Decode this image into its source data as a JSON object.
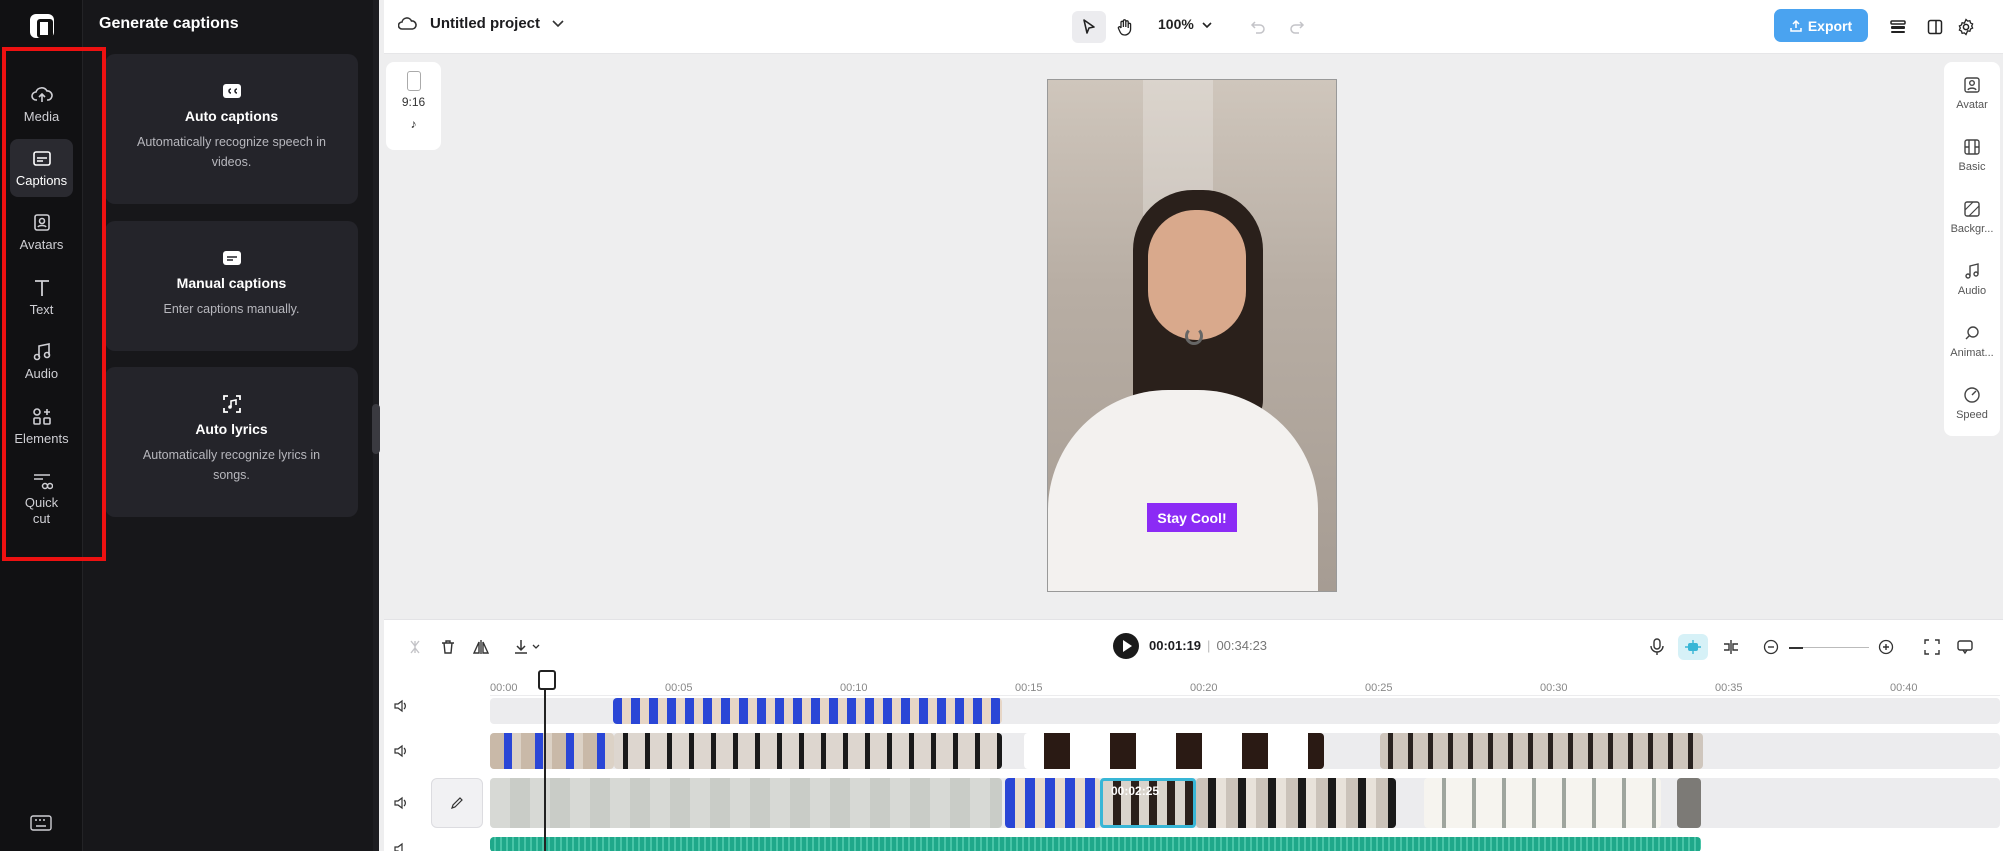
{
  "rail": {
    "items": [
      {
        "label": "Media",
        "icon": "cloud-upload-icon"
      },
      {
        "label": "Captions",
        "icon": "captions-icon"
      },
      {
        "label": "Avatars",
        "icon": "avatar-icon"
      },
      {
        "label": "Text",
        "icon": "text-icon"
      },
      {
        "label": "Audio",
        "icon": "music-note-icon"
      },
      {
        "label": "Elements",
        "icon": "elements-icon"
      },
      {
        "label": "Quick",
        "label2": "cut",
        "icon": "scissors-icon"
      }
    ],
    "active": "Captions"
  },
  "panel": {
    "title": "Generate captions",
    "cards": [
      {
        "title": "Auto captions",
        "desc": "Automatically recognize speech in videos.",
        "icon": "cc-icon"
      },
      {
        "title": "Manual captions",
        "desc": "Enter captions manually.",
        "icon": "subtitles-icon"
      },
      {
        "title": "Auto lyrics",
        "desc": "Automatically recognize lyrics in songs.",
        "icon": "lyrics-icon"
      }
    ]
  },
  "topbar": {
    "project_name": "Untitled project",
    "zoom": "100%",
    "export_label": "Export"
  },
  "ratio": {
    "label": "9:16"
  },
  "canvas": {
    "caption": "Stay Cool!"
  },
  "right_tools": [
    {
      "label": "Avatar"
    },
    {
      "label": "Basic"
    },
    {
      "label": "Backgr..."
    },
    {
      "label": "Audio"
    },
    {
      "label": "Animat..."
    },
    {
      "label": "Speed"
    }
  ],
  "timeline": {
    "current_time": "00:01:19",
    "total_time": "00:34:23",
    "ruler": [
      "00:00",
      "00:05",
      "00:10",
      "00:15",
      "00:20",
      "00:25",
      "00:30",
      "00:35",
      "00:40"
    ],
    "selected_clip_time": "00:02:25"
  },
  "colors": {
    "accent": "#4aa3f0",
    "caption_bg": "#8b2bf5",
    "selection": "#38b6d6",
    "audio_track": "#1fa88a",
    "highlight": "#ee1111"
  }
}
